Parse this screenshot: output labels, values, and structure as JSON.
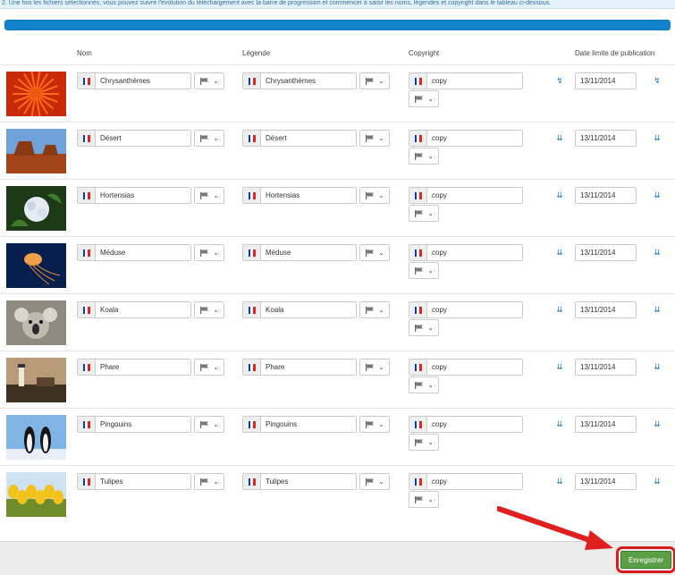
{
  "notice": "2. Une fois les fichiers sélectionnés, vous pouvez suivre l'évolution du téléchargement avec la barre de progression et commencer à saisir les noms, légendes et copyright dans le tableau ci-dessous.",
  "progress": 1.0,
  "colors": {
    "accent": "#1382cc",
    "save": "#5a9e45",
    "highlight": "#d51d1d"
  },
  "headers": {
    "nom": "Nom",
    "legende": "Légende",
    "copyright": "Copyright",
    "date": "Date limite de publication"
  },
  "rows": [
    {
      "nom": "Chrysanthèmes",
      "legende": "Chrysanthèmes",
      "copyright": "copy",
      "date": "13/11/2014",
      "icon": "bolt-icon",
      "thumb": "chrysanthemum"
    },
    {
      "nom": "Désert",
      "legende": "Désert",
      "copyright": "copy",
      "date": "13/11/2014",
      "icon": "double-chevron-icon",
      "thumb": "desert"
    },
    {
      "nom": "Hortensias",
      "legende": "Hortensias",
      "copyright": "copy",
      "date": "13/11/2014",
      "icon": "double-chevron-icon",
      "thumb": "hydrangea"
    },
    {
      "nom": "Méduse",
      "legende": "Méduse",
      "copyright": "copy",
      "date": "13/11/2014",
      "icon": "double-chevron-icon",
      "thumb": "jellyfish"
    },
    {
      "nom": "Koala",
      "legende": "Koala",
      "copyright": "copy",
      "date": "13/11/2014",
      "icon": "double-chevron-icon",
      "thumb": "koala"
    },
    {
      "nom": "Phare",
      "legende": "Phare",
      "copyright": "copy",
      "date": "13/11/2014",
      "icon": "double-chevron-icon",
      "thumb": "lighthouse"
    },
    {
      "nom": "Pingouins",
      "legende": "Pingouins",
      "copyright": "copy",
      "date": "13/11/2014",
      "icon": "double-chevron-icon",
      "thumb": "penguins"
    },
    {
      "nom": "Tulipes",
      "legende": "Tulipes",
      "copyright": "copy",
      "date": "13/11/2014",
      "icon": "double-chevron-icon",
      "thumb": "tulips"
    }
  ],
  "save_label": "Enregistrer"
}
